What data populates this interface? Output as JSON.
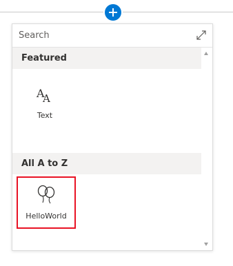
{
  "search": {
    "placeholder": "Search"
  },
  "sections": [
    {
      "title": "Featured",
      "items": [
        {
          "label": "Text",
          "icon": "text-icon"
        }
      ]
    },
    {
      "title": "All A to Z",
      "items": [
        {
          "label": "HelloWorld",
          "icon": "balloons-icon",
          "highlighted": true
        }
      ]
    }
  ],
  "colors": {
    "accent": "#0078d4",
    "highlight_border": "#e81123",
    "section_bg": "#f3f2f1",
    "text": "#323130"
  },
  "icons": {
    "add": "plus-icon",
    "expand": "expand-icon",
    "scroll_up": "chevron-up-icon",
    "scroll_down": "chevron-down-icon"
  }
}
